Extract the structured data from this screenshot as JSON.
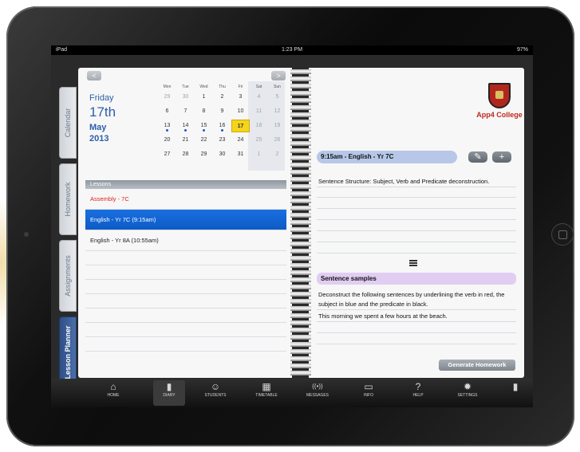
{
  "status": {
    "device": "iPad",
    "time": "1:23 PM",
    "battery": "97%"
  },
  "side_tabs": [
    {
      "label": "Calendar"
    },
    {
      "label": "Homework"
    },
    {
      "label": "Assignments"
    },
    {
      "label": "Lesson Planner",
      "active": true
    }
  ],
  "nav": {
    "prev": "<",
    "next": ">"
  },
  "date": {
    "weekday": "Friday",
    "day": "17th",
    "month": "May",
    "year": "2013"
  },
  "calendar": {
    "weekdays": [
      "Mon",
      "Tue",
      "Wed",
      "Thu",
      "Fri",
      "Sat",
      "Sun"
    ],
    "rows": [
      [
        "29",
        "30",
        "1",
        "2",
        "3",
        "4",
        "5"
      ],
      [
        "6",
        "7",
        "8",
        "9",
        "10",
        "11",
        "12"
      ],
      [
        "13",
        "14",
        "15",
        "16",
        "17",
        "18",
        "19"
      ],
      [
        "20",
        "21",
        "22",
        "23",
        "24",
        "25",
        "26"
      ],
      [
        "27",
        "28",
        "29",
        "30",
        "31",
        "1",
        "2"
      ]
    ],
    "selected": "17"
  },
  "lessons": {
    "header": "Lessons",
    "items": [
      {
        "label": "Assembly - 7C",
        "style": "red"
      },
      {
        "label": "English - Yr 7C (9:15am)",
        "style": "selected"
      },
      {
        "label": "English - Yr 8A (10:55am)",
        "style": "normal"
      }
    ]
  },
  "logo": {
    "text": "App4 College"
  },
  "detail": {
    "title": "9:15am - English - Yr 7C",
    "edit_icon": "pencil-icon",
    "add_icon": "plus-icon",
    "notes": "Sentence Structure: Subject, Verb and Predicate deconstruction.",
    "section_title": "Sentence samples",
    "para1": "Deconstruct the following sentences by underlining the verb in red, the subject in blue and the predicate in black.",
    "para2": "This morning we spent a few hours at the beach.",
    "generate": "Generate Homework"
  },
  "toolbar": [
    {
      "label": "HOME",
      "icon": "home-icon"
    },
    {
      "label": "DIARY",
      "icon": "diary-icon",
      "active": true
    },
    {
      "label": "STUDENTS",
      "icon": "students-icon"
    },
    {
      "label": "TIMETABLE",
      "icon": "timetable-icon"
    },
    {
      "label": "MESSAGES",
      "icon": "messages-icon"
    },
    {
      "label": "INFO",
      "icon": "info-icon"
    },
    {
      "label": "HELP",
      "icon": "help-icon"
    },
    {
      "label": "SETTINGS",
      "icon": "settings-icon"
    },
    {
      "label": "",
      "icon": "trash-icon"
    }
  ]
}
